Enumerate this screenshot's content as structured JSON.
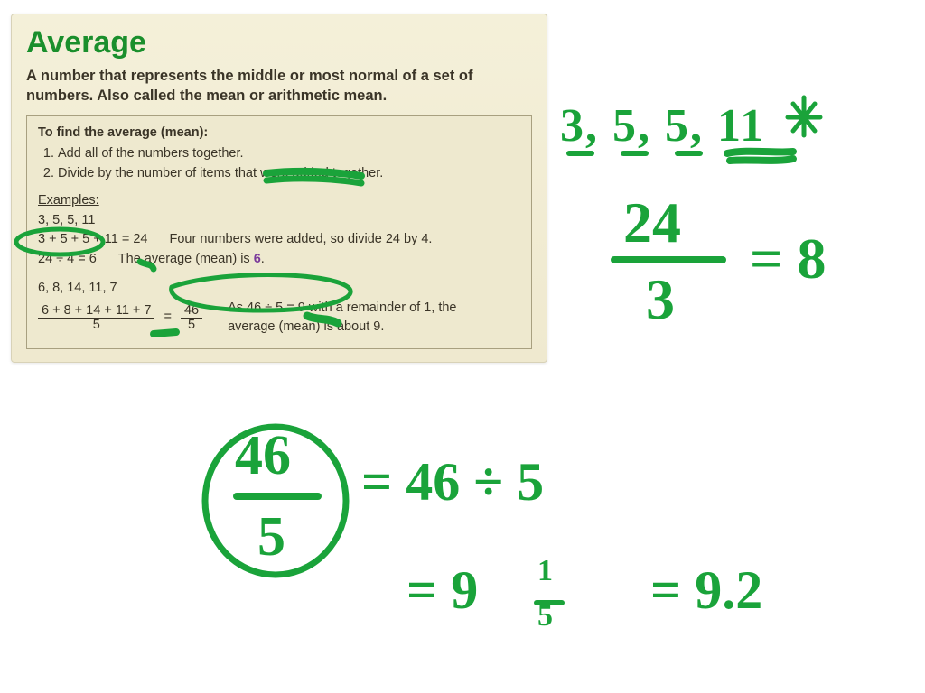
{
  "card": {
    "title": "Average",
    "definition": "A number that represents the middle or most normal of a set of numbers. Also called the mean or arithmetic mean.",
    "steps_intro": "To find the average (mean):",
    "step1": "Add all of the numbers together.",
    "step2": "Divide by the number of items that were added together.",
    "examples_label": "Examples:",
    "ex1_set": "3, 5, 5, 11",
    "ex1_sum": "3 + 5 + 5 + 11 = 24",
    "ex1_note": "Four numbers were added, so divide 24 by 4.",
    "ex1_div": "24 ÷ 4 = 6",
    "ex1_result_pre": "The average (mean) is ",
    "ex1_result_val": "6",
    "ex1_result_post": ".",
    "ex2_set": "6, 8, 14, 11, 7",
    "ex2_frac_top": "6 + 8 + 14 + 11 + 7",
    "ex2_frac_bot": "5",
    "ex2_eq": "=",
    "ex2_frac2_top": "46",
    "ex2_frac2_bot": "5",
    "ex2_note": "As 46 ÷ 5 = 9 with a remainder of 1, the average (mean) is about 9."
  },
  "handwriting": {
    "list": "3, 5, 5, 11",
    "star": "*",
    "twentyfour": "24",
    "three": "3",
    "eq8": "= 8",
    "fortysix": "46",
    "five": "5",
    "rhs1": "= 46 ÷ 5",
    "rhs2a": "= 9",
    "rhs2_onefifth_top": "1",
    "rhs2_onefifth_bot": "5",
    "rhs3": "= 9.2"
  }
}
